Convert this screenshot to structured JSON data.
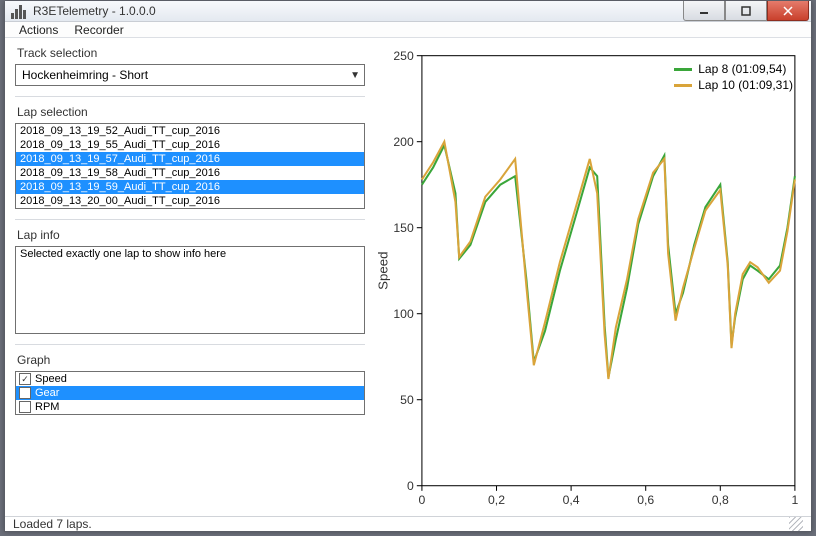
{
  "window": {
    "title": "R3ETelemetry - 1.0.0.0"
  },
  "menu": {
    "actions": "Actions",
    "recorder": "Recorder"
  },
  "track": {
    "label": "Track selection",
    "value": "Hockenheimring - Short"
  },
  "laps": {
    "label": "Lap selection",
    "items": [
      {
        "name": "2018_09_13_19_52_Audi_TT_cup_2016",
        "selected": false
      },
      {
        "name": "2018_09_13_19_55_Audi_TT_cup_2016",
        "selected": false
      },
      {
        "name": "2018_09_13_19_57_Audi_TT_cup_2016",
        "selected": true
      },
      {
        "name": "2018_09_13_19_58_Audi_TT_cup_2016",
        "selected": false
      },
      {
        "name": "2018_09_13_19_59_Audi_TT_cup_2016",
        "selected": true
      },
      {
        "name": "2018_09_13_20_00_Audi_TT_cup_2016",
        "selected": false
      }
    ]
  },
  "lapinfo": {
    "label": "Lap info",
    "text": "Selected exactly one lap to show info here"
  },
  "graph": {
    "label": "Graph",
    "items": [
      {
        "name": "Speed",
        "checked": true,
        "selected": false
      },
      {
        "name": "Gear",
        "checked": false,
        "selected": true
      },
      {
        "name": "RPM",
        "checked": false,
        "selected": false
      }
    ]
  },
  "status": {
    "text": "Loaded 7 laps."
  },
  "chart_data": {
    "type": "line",
    "ylabel": "Speed",
    "xlabel": "",
    "xlim": [
      0,
      1
    ],
    "ylim": [
      0,
      250
    ],
    "xticks": [
      0,
      0.2,
      0.4,
      0.6,
      0.8,
      1
    ],
    "yticks": [
      0,
      50,
      100,
      150,
      200,
      250
    ],
    "xtick_labels": [
      "0",
      "0,2",
      "0,4",
      "0,6",
      "0,8",
      "1"
    ],
    "ytick_labels": [
      "0",
      "50",
      "100",
      "150",
      "200",
      "250"
    ],
    "series": [
      {
        "name": "Lap 8 (01:09,54)",
        "color": "#3aa63a",
        "x": [
          0,
          0.03,
          0.06,
          0.09,
          0.1,
          0.13,
          0.17,
          0.21,
          0.25,
          0.28,
          0.3,
          0.33,
          0.37,
          0.41,
          0.45,
          0.47,
          0.49,
          0.5,
          0.52,
          0.55,
          0.58,
          0.62,
          0.65,
          0.66,
          0.68,
          0.7,
          0.73,
          0.76,
          0.8,
          0.82,
          0.83,
          0.84,
          0.86,
          0.88,
          0.9,
          0.93,
          0.96,
          0.98,
          1.0
        ],
        "values": [
          175,
          185,
          198,
          170,
          132,
          140,
          165,
          175,
          180,
          120,
          72,
          90,
          125,
          155,
          185,
          180,
          93,
          63,
          85,
          115,
          152,
          180,
          192,
          140,
          100,
          112,
          140,
          162,
          175,
          130,
          82,
          98,
          120,
          128,
          125,
          120,
          128,
          150,
          180
        ]
      },
      {
        "name": "Lap 10 (01:09,31)",
        "color": "#d9a43a",
        "x": [
          0,
          0.03,
          0.06,
          0.09,
          0.1,
          0.13,
          0.17,
          0.21,
          0.25,
          0.28,
          0.3,
          0.33,
          0.37,
          0.41,
          0.45,
          0.47,
          0.49,
          0.5,
          0.52,
          0.55,
          0.58,
          0.62,
          0.65,
          0.66,
          0.68,
          0.7,
          0.73,
          0.76,
          0.8,
          0.82,
          0.83,
          0.84,
          0.86,
          0.88,
          0.9,
          0.93,
          0.96,
          0.98,
          1.0
        ],
        "values": [
          178,
          188,
          200,
          165,
          133,
          142,
          168,
          178,
          190,
          116,
          70,
          95,
          130,
          160,
          190,
          170,
          88,
          62,
          92,
          120,
          155,
          182,
          190,
          135,
          96,
          115,
          138,
          160,
          172,
          128,
          80,
          100,
          123,
          130,
          127,
          118,
          125,
          148,
          178
        ]
      }
    ]
  }
}
